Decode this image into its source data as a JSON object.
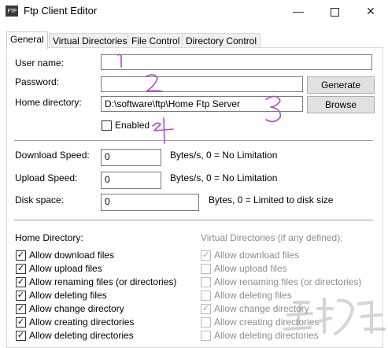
{
  "window": {
    "icon_text": "FTP",
    "title": "Ftp Client Editor",
    "minimize": "—",
    "close": "✕"
  },
  "tabs": [
    {
      "label": "General",
      "active": true
    },
    {
      "label": "Virtual Directories",
      "active": false
    },
    {
      "label": "File Control",
      "active": false
    },
    {
      "label": "Directory Control",
      "active": false
    }
  ],
  "account": {
    "user_name_label": "User name:",
    "user_name_value": "",
    "password_label": "Password:",
    "password_value": "",
    "generate_button": "Generate",
    "home_dir_label": "Home directory:",
    "home_dir_value": "D:\\software\\ftp\\Home Ftp Server",
    "browse_button": "Browse",
    "enabled_label": "Enabled",
    "enabled_checked": false
  },
  "limits": {
    "download_label": "Download Speed:",
    "download_value": "0",
    "download_hint": "Bytes/s, 0 = No Limitation",
    "upload_label": "Upload Speed:",
    "upload_value": "0",
    "upload_hint": "Bytes/s, 0 = No Limitation",
    "disk_label": "Disk space:",
    "disk_value": "0",
    "disk_hint": "Bytes, 0 = Limited to disk size"
  },
  "home_permissions": {
    "title": "Home Directory:",
    "items": [
      {
        "label": "Allow download files",
        "checked": true
      },
      {
        "label": "Allow upload files",
        "checked": true
      },
      {
        "label": "Allow renaming files (or directories)",
        "checked": true
      },
      {
        "label": "Allow deleting files",
        "checked": true
      },
      {
        "label": "Allow change directory",
        "checked": true
      },
      {
        "label": "Allow creating directories",
        "checked": true
      },
      {
        "label": "Allow deleting directories",
        "checked": true
      }
    ]
  },
  "virtual_permissions": {
    "title": "Virtual Directories (if any defined):",
    "items": [
      {
        "label": "Allow download files",
        "checked": true
      },
      {
        "label": "Allow upload files",
        "checked": false
      },
      {
        "label": "Allow renaming files (or directories)",
        "checked": false
      },
      {
        "label": "Allow deleting files",
        "checked": false
      },
      {
        "label": "Allow change directory",
        "checked": true
      },
      {
        "label": "Allow creating directories",
        "checked": false
      },
      {
        "label": "Allow deleting directories",
        "checked": false
      }
    ]
  },
  "annotations": {
    "color": "#b545d8",
    "marks": [
      "1",
      "2",
      "3",
      "4"
    ]
  }
}
